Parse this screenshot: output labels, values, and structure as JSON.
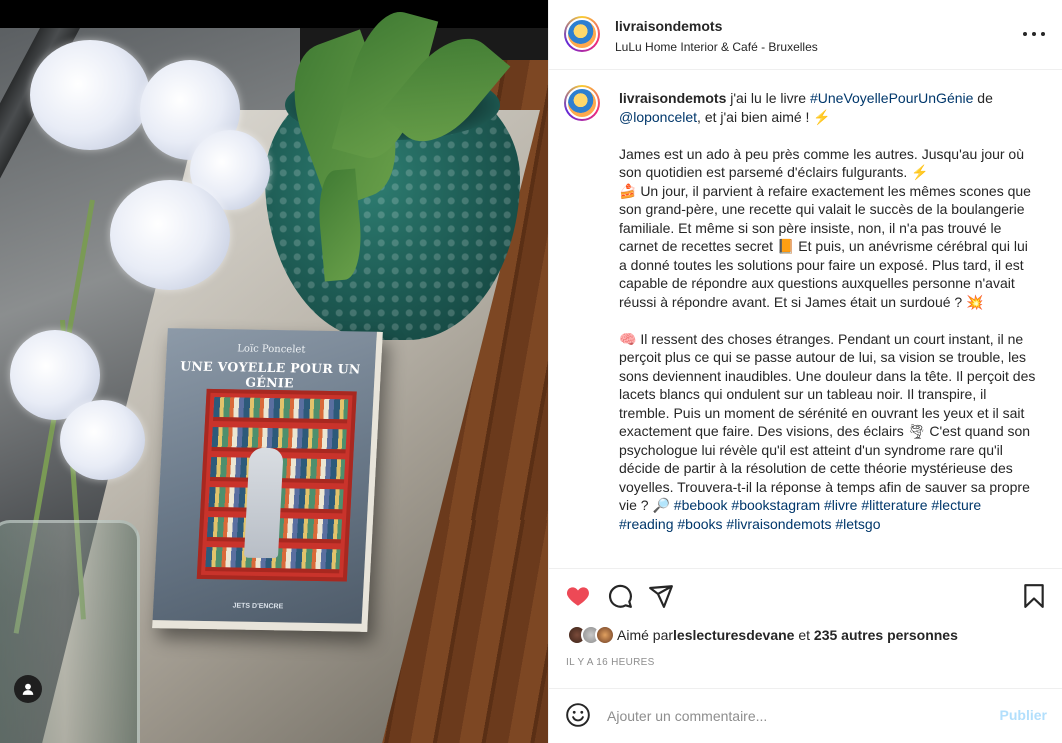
{
  "post": {
    "username": "livraisondemots",
    "location": "LuLu Home Interior & Café - Bruxelles"
  },
  "photo": {
    "book_author": "Loïc Poncelet",
    "book_title": "UNE VOYELLE POUR UN GÉNIE",
    "book_publisher": "JETS D'ENCRE"
  },
  "caption": {
    "username": "livraisondemots",
    "intro_1": " j'ai lu le livre ",
    "intro_tag": "#UneVoyellePourUnGénie",
    "intro_2": " de ",
    "intro_mention": "@loponcelet",
    "intro_3": ", et j'ai bien aimé ! ⚡",
    "para1": "James est un ado à peu près comme les autres. Jusqu'au jour où son quotidien est parsemé d'éclairs fulgurants. ⚡\n🍰 Un jour, il parvient à refaire exactement les mêmes scones que son grand-père, une recette qui valait le succès de la boulangerie familiale. Et même si son père insiste, non, il n'a pas trouvé le carnet de recettes secret 📙 Et puis, un anévrisme cérébral qui lui a donné toutes les solutions pour faire un exposé. Plus tard, il est capable de répondre aux questions auxquelles personne n'avait réussi à répondre avant. Et si James était un surdoué ? 💥",
    "para2": "🧠 Il ressent des choses étranges. Pendant un court instant, il ne perçoit plus ce qui se passe autour de lui, sa vision se trouble, les sons deviennent inaudibles. Une douleur dans la tête. Il perçoit des lacets blancs qui ondulent sur un tableau noir. Il transpire, il tremble. Puis un moment de sérénité en ouvrant les yeux et il sait exactement que faire. Des visions, des éclairs 🌪 C'est quand son psychologue lui révèle qu'il est atteint d'un syndrome rare qu'il décide de partir à la résolution de cette théorie mystérieuse des voyelles. Trouvera-t-il la réponse à temps afin de sauver sa propre vie ? 🔎",
    "hashtags": "#bebook #bookstagram #livre #litterature #lecture #reading #books #livraisondemots #letsgo"
  },
  "likes": {
    "prefix": "Aimé par ",
    "user": "leslecturesdevane",
    "middle": " et ",
    "count": "235 autres personnes"
  },
  "timestamp": "IL Y A 16 HEURES",
  "comment": {
    "placeholder": "Ajouter un commentaire...",
    "publish_label": "Publier"
  },
  "colors": {
    "like_red": "#ed4956",
    "link_blue": "#00376b",
    "publish_disabled": "#b2dffc"
  },
  "icons": [
    "heart-icon",
    "comment-icon",
    "share-icon",
    "bookmark-icon",
    "emoji-icon",
    "more-options-icon",
    "user-tag-icon"
  ]
}
